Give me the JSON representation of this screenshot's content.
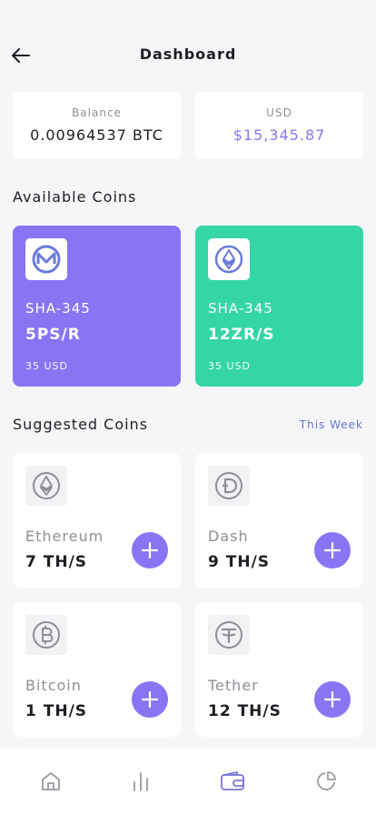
{
  "header": {
    "title": "Dashboard",
    "back_icon": "arrow-left-icon"
  },
  "stats": {
    "balance": {
      "label": "Balance",
      "value": "0.00964537 BTC"
    },
    "usd": {
      "label": "USD",
      "value": "$15,345.87",
      "color": "#8a78ec"
    }
  },
  "available": {
    "title": "Available Coins",
    "items": [
      {
        "icon": "monero-icon",
        "name": "SHA-345",
        "rate": "5PS/R",
        "usd": "35 USD",
        "color": "#8b74f4"
      },
      {
        "icon": "ethereum-icon",
        "name": "SHA-345",
        "rate": "12ZR/S",
        "usd": "35 USD",
        "color": "#35d6a5"
      }
    ]
  },
  "suggested": {
    "title": "Suggested Coins",
    "filter": "This Week",
    "items": [
      {
        "icon": "ethereum-icon",
        "name": "Ethereum",
        "rate": "7 TH/S"
      },
      {
        "icon": "dash-icon",
        "name": "Dash",
        "rate": "9 TH/S"
      },
      {
        "icon": "bitcoin-icon",
        "name": "Bitcoin",
        "rate": "1 TH/S"
      },
      {
        "icon": "tether-icon",
        "name": "Tether",
        "rate": "12 TH/S"
      }
    ]
  },
  "tabs": [
    {
      "icon": "home-icon"
    },
    {
      "icon": "bar-chart-icon"
    },
    {
      "icon": "wallet-icon",
      "active": true
    },
    {
      "icon": "pie-chart-icon"
    }
  ],
  "colors": {
    "accent": "#8b74f4",
    "green": "#35d6a5",
    "active_tab": "#7a72d8"
  }
}
